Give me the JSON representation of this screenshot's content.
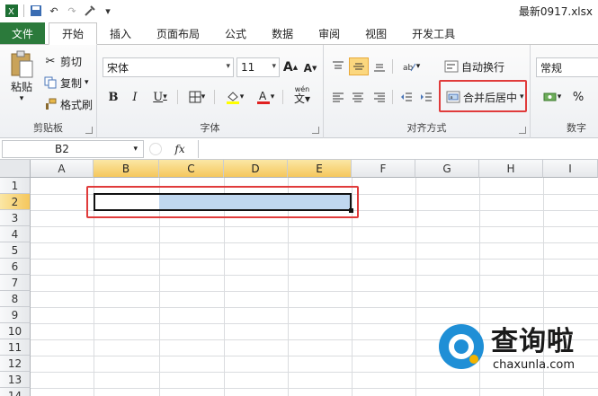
{
  "window": {
    "doc_title": "最新0917.xlsx"
  },
  "quick_access": {
    "save": "💾",
    "undo": "↶",
    "redo": "↷",
    "customize": "▾"
  },
  "tabs": [
    {
      "label": "文件"
    },
    {
      "label": "开始"
    },
    {
      "label": "插入"
    },
    {
      "label": "页面布局"
    },
    {
      "label": "公式"
    },
    {
      "label": "数据"
    },
    {
      "label": "审阅"
    },
    {
      "label": "视图"
    },
    {
      "label": "开发工具"
    }
  ],
  "clipboard": {
    "paste_label": "粘贴",
    "cut_label": "剪切",
    "copy_label": "复制",
    "format_painter_label": "格式刷",
    "group_label": "剪贴板"
  },
  "font": {
    "family": "宋体",
    "size": "11",
    "grow": "A",
    "shrink": "A",
    "bold": "B",
    "italic": "I",
    "underline": "U",
    "wen": "wén",
    "group_label": "字体"
  },
  "alignment": {
    "wrap_text_label": "自动换行",
    "merge_center_label": "合并后居中",
    "group_label": "对齐方式"
  },
  "number": {
    "format": "常规",
    "percent": "%",
    "group_label": "数字"
  },
  "formula_bar": {
    "name_box": "B2",
    "fx": "fx",
    "content": ""
  },
  "grid": {
    "columns": [
      "A",
      "B",
      "C",
      "D",
      "E",
      "F",
      "G",
      "H",
      "I"
    ],
    "rows": [
      "1",
      "2",
      "3",
      "4",
      "5",
      "6",
      "7",
      "8",
      "9",
      "10",
      "11",
      "12",
      "13",
      "14"
    ],
    "selected_columns": [
      "B",
      "C",
      "D",
      "E"
    ],
    "selected_row": "2",
    "active_cell": "B2"
  },
  "watermark": {
    "name": "查询啦",
    "url": "chaxunla.com"
  },
  "colors": {
    "file_tab": "#2b7a3b",
    "highlight": "#e03b3b",
    "selection": "#c0d7ef",
    "header_selected": "#f5c75c",
    "watermark_blue": "#1f8fd6"
  }
}
